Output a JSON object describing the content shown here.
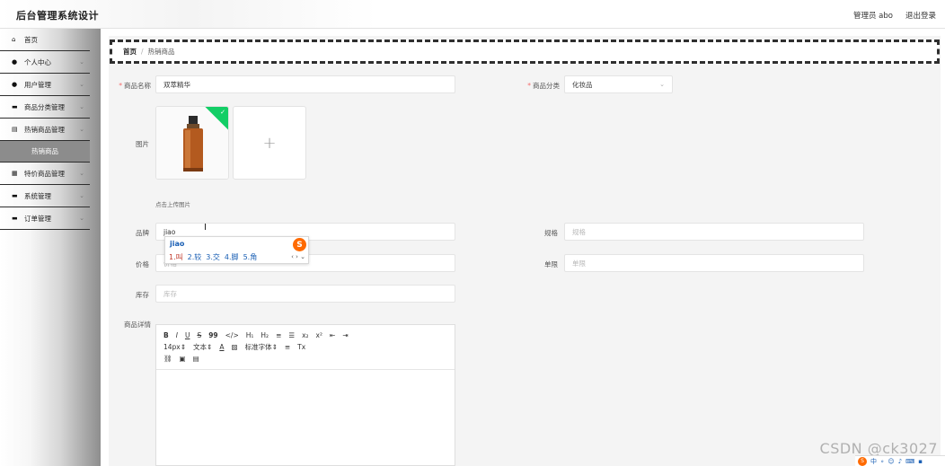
{
  "header": {
    "title": "后台管理系统设计",
    "user": "管理员 abo",
    "logout": "退出登录"
  },
  "sidebar": {
    "items": [
      {
        "label": "首页",
        "icon": "home-icon",
        "glyph": "⌂",
        "chevron": false
      },
      {
        "label": "个人中心",
        "icon": "user-icon",
        "glyph": "●",
        "chevron": true
      },
      {
        "label": "用户管理",
        "icon": "user-icon",
        "glyph": "●",
        "chevron": true
      },
      {
        "label": "商品分类管理",
        "icon": "folder-icon",
        "glyph": "▬",
        "chevron": true
      },
      {
        "label": "热销商品管理",
        "icon": "document-icon",
        "glyph": "▤",
        "chevron": true
      }
    ],
    "active_sub": "热销商品",
    "items_after": [
      {
        "label": "特价商品管理",
        "icon": "grid-icon",
        "glyph": "▦",
        "chevron": true
      },
      {
        "label": "系统管理",
        "icon": "monitor-icon",
        "glyph": "▬",
        "chevron": true
      },
      {
        "label": "订单管理",
        "icon": "list-icon",
        "glyph": "▬",
        "chevron": true
      }
    ]
  },
  "breadcrumb": {
    "home": "首页",
    "separator": "/",
    "current": "热销商品"
  },
  "form": {
    "name": {
      "label": "商品名称",
      "value": "双萃精华"
    },
    "category": {
      "label": "商品分类",
      "value": "化妆品"
    },
    "image": {
      "label": "图片",
      "tip": "点击上传图片"
    },
    "brand": {
      "label": "品牌",
      "value": "jiao"
    },
    "spec": {
      "label": "规格",
      "placeholder": "规格"
    },
    "price": {
      "label": "价格",
      "placeholder": "价格"
    },
    "unit": {
      "label": "单限",
      "placeholder": "单限"
    },
    "stock": {
      "label": "库存",
      "placeholder": "库存"
    },
    "detail": {
      "label": "商品详情"
    }
  },
  "ime": {
    "composition": "jiao",
    "candidates": [
      "1.叫",
      "2.较",
      "3.交",
      "4.脚",
      "5.角"
    ],
    "logo": "S"
  },
  "editor": {
    "row1": [
      "B",
      "I",
      "U",
      "S",
      "99",
      "</>",
      "H₁",
      "H₂",
      "≡",
      "☰",
      "x₂",
      "x²",
      "⇤",
      "⇥"
    ],
    "size": "14px",
    "block": "文本",
    "font": "标准字体",
    "color": "A",
    "clean": "Tx"
  },
  "watermark": "CSDN @ck3027",
  "tray": {
    "mode": "中",
    "logo": "S"
  },
  "colors": {
    "upload_check": "#13ce66",
    "ime_logo": "#ff6a00",
    "required": "#f56c6c"
  }
}
